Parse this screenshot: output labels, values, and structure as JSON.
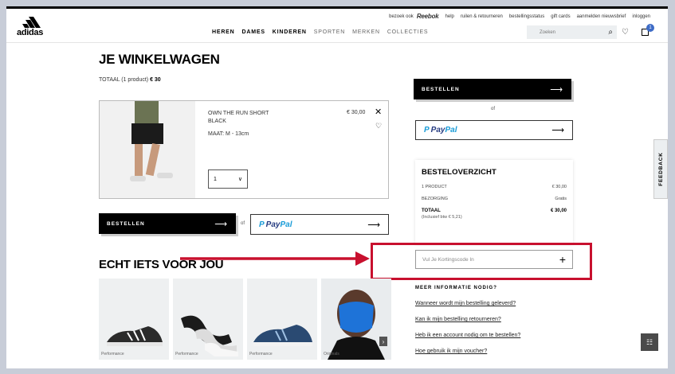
{
  "header": {
    "brand": "adidas",
    "util_links": {
      "reebok_prefix": "bezoek ook",
      "reebok": "Reebok",
      "help": "help",
      "returns": "ruilen & retourneren",
      "order_status": "bestellingsstatus",
      "gift_cards": "gift cards",
      "newsletter": "aanmelden nieuwsbrief",
      "login": "inloggen"
    },
    "nav": [
      "HEREN",
      "DAMES",
      "KINDEREN",
      "SPORTEN",
      "MERKEN",
      "COLLECTIES"
    ],
    "search_placeholder": "Zoeken",
    "bag_count": "1"
  },
  "cart": {
    "title": "JE WINKELWAGEN",
    "total_label": "TOTAAL (1 product)",
    "total_value": "€ 30",
    "item": {
      "name": "OWN THE RUN SHORT BLACK",
      "size": "MAAT: M - 13cm",
      "price": "€ 30,00",
      "quantity": "1"
    },
    "checkout_label": "BESTELLEN",
    "or": "of",
    "paypal_a": "Pay",
    "paypal_b": "Pal"
  },
  "recommendations": {
    "title": "ECHT IETS VOOR JOU",
    "items": [
      {
        "label": "Performance"
      },
      {
        "label": "Performance"
      },
      {
        "label": "Performance"
      },
      {
        "label": "Originals"
      }
    ]
  },
  "summary": {
    "title": "BESTELOVERZICHT",
    "products_label": "1 PRODUCT",
    "products_value": "€ 30,00",
    "shipping_label": "BEZORGING",
    "shipping_value": "Gratis",
    "total_label": "TOTAAL",
    "total_value": "€ 30,00",
    "vat_note": "(Inclusief btw  € 5,21)"
  },
  "promo": {
    "placeholder": "Vul Je Kortingscode In"
  },
  "info": {
    "title": "MEER INFORMATIE NODIG?",
    "links": [
      "Wanneer wordt mijn bestelling geleverd?",
      "Kan ik mijn bestelling retourneren?",
      "Heb ik een account nodig om te bestellen?",
      "Hoe gebruik ik mijn voucher?"
    ]
  },
  "feedback_label": "FEEDBACK",
  "colors": {
    "highlight": "#c8102e",
    "badge": "#3d6bc6",
    "paypal_dark": "#253b80",
    "paypal_light": "#179bd7"
  }
}
